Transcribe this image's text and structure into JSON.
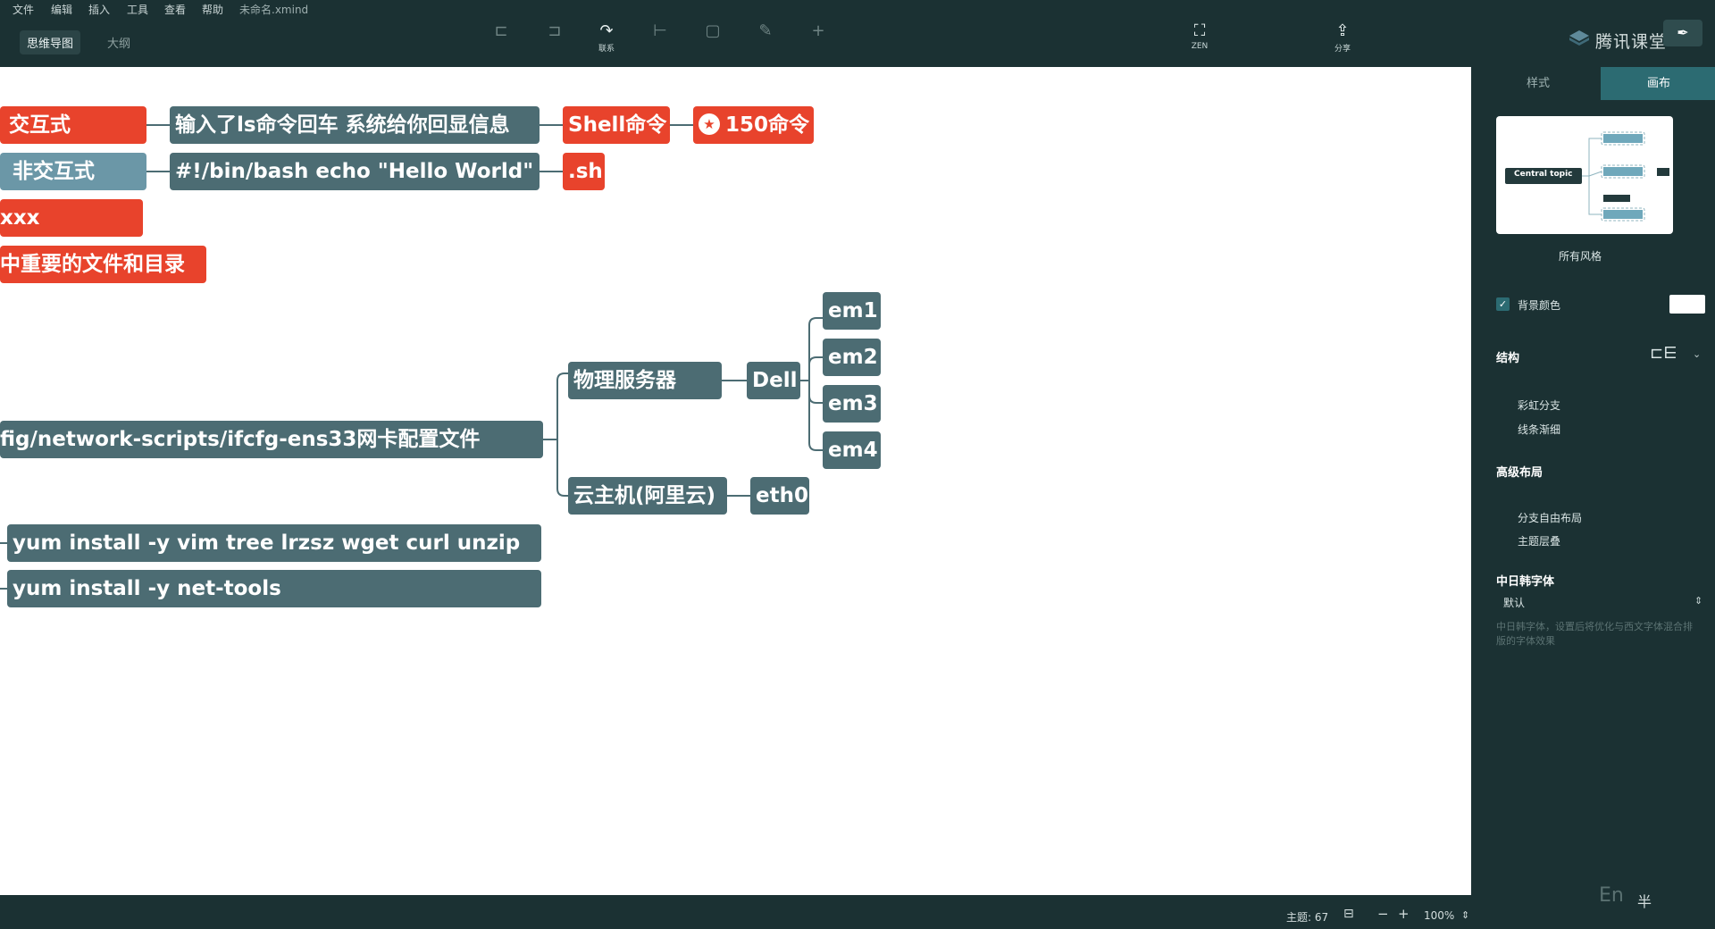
{
  "menu": [
    "文件",
    "编辑",
    "插入",
    "工具",
    "查看",
    "帮助"
  ],
  "document_title": "未命名.xmind",
  "view_tabs": [
    "思维导图",
    "大纲"
  ],
  "toolbar": {
    "relationship_label": "联系",
    "zen_label": "ZEN",
    "share_label": "分享"
  },
  "brand_text": "腾讯课堂",
  "canvas": {
    "nodes": {
      "interactive": "交互式",
      "interactive_desc": "输入了ls命令回车 系统给你回显信息",
      "shell_cmd": "Shell命令",
      "cmd150": "150命令",
      "non_interactive": "非交互式",
      "script_line": "#!/bin/bash  echo \"Hello World\"",
      "sh_ext": ".sh",
      "xxx": "xxx",
      "important_files": "中重要的文件和目录",
      "ifcfg_path": "fig/network-scripts/ifcfg-ens33网卡配置文件",
      "physical_server": "物理服务器",
      "dell": "Dell",
      "em1": "em1",
      "em2": "em2",
      "em3": "em3",
      "em4": "em4",
      "cloud_host": "云主机(阿里云)",
      "eth0": "eth0",
      "yum1": "yum install -y vim  tree lrzsz wget curl unzip",
      "yum2": "yum install -y net-tools"
    }
  },
  "panel": {
    "tab_style": "样式",
    "tab_canvas": "画布",
    "preview_central": "Central topic",
    "all_styles": "所有风格",
    "bg_color": "背景颜色",
    "structure": "结构",
    "rainbow_branch": "彩虹分支",
    "line_taper": "线条渐细",
    "advanced_layout": "高级布局",
    "free_layout": "分支自由布局",
    "topic_overlap": "主题层叠",
    "cjk_font": "中日韩字体",
    "cjk_default": "默认",
    "cjk_hint": "中日韩字体，设置后将优化与西文字体混合排版的字体效果"
  },
  "status": {
    "topics_label": "主题: 67",
    "zoom": "100%"
  },
  "ime": {
    "mode": "En",
    "width": "半"
  },
  "colors": {
    "red": "#e8432c",
    "slate": "#4c6c73",
    "blue": "#6b97a7",
    "accent": "#2c6b72",
    "chrome": "#1b3133"
  }
}
